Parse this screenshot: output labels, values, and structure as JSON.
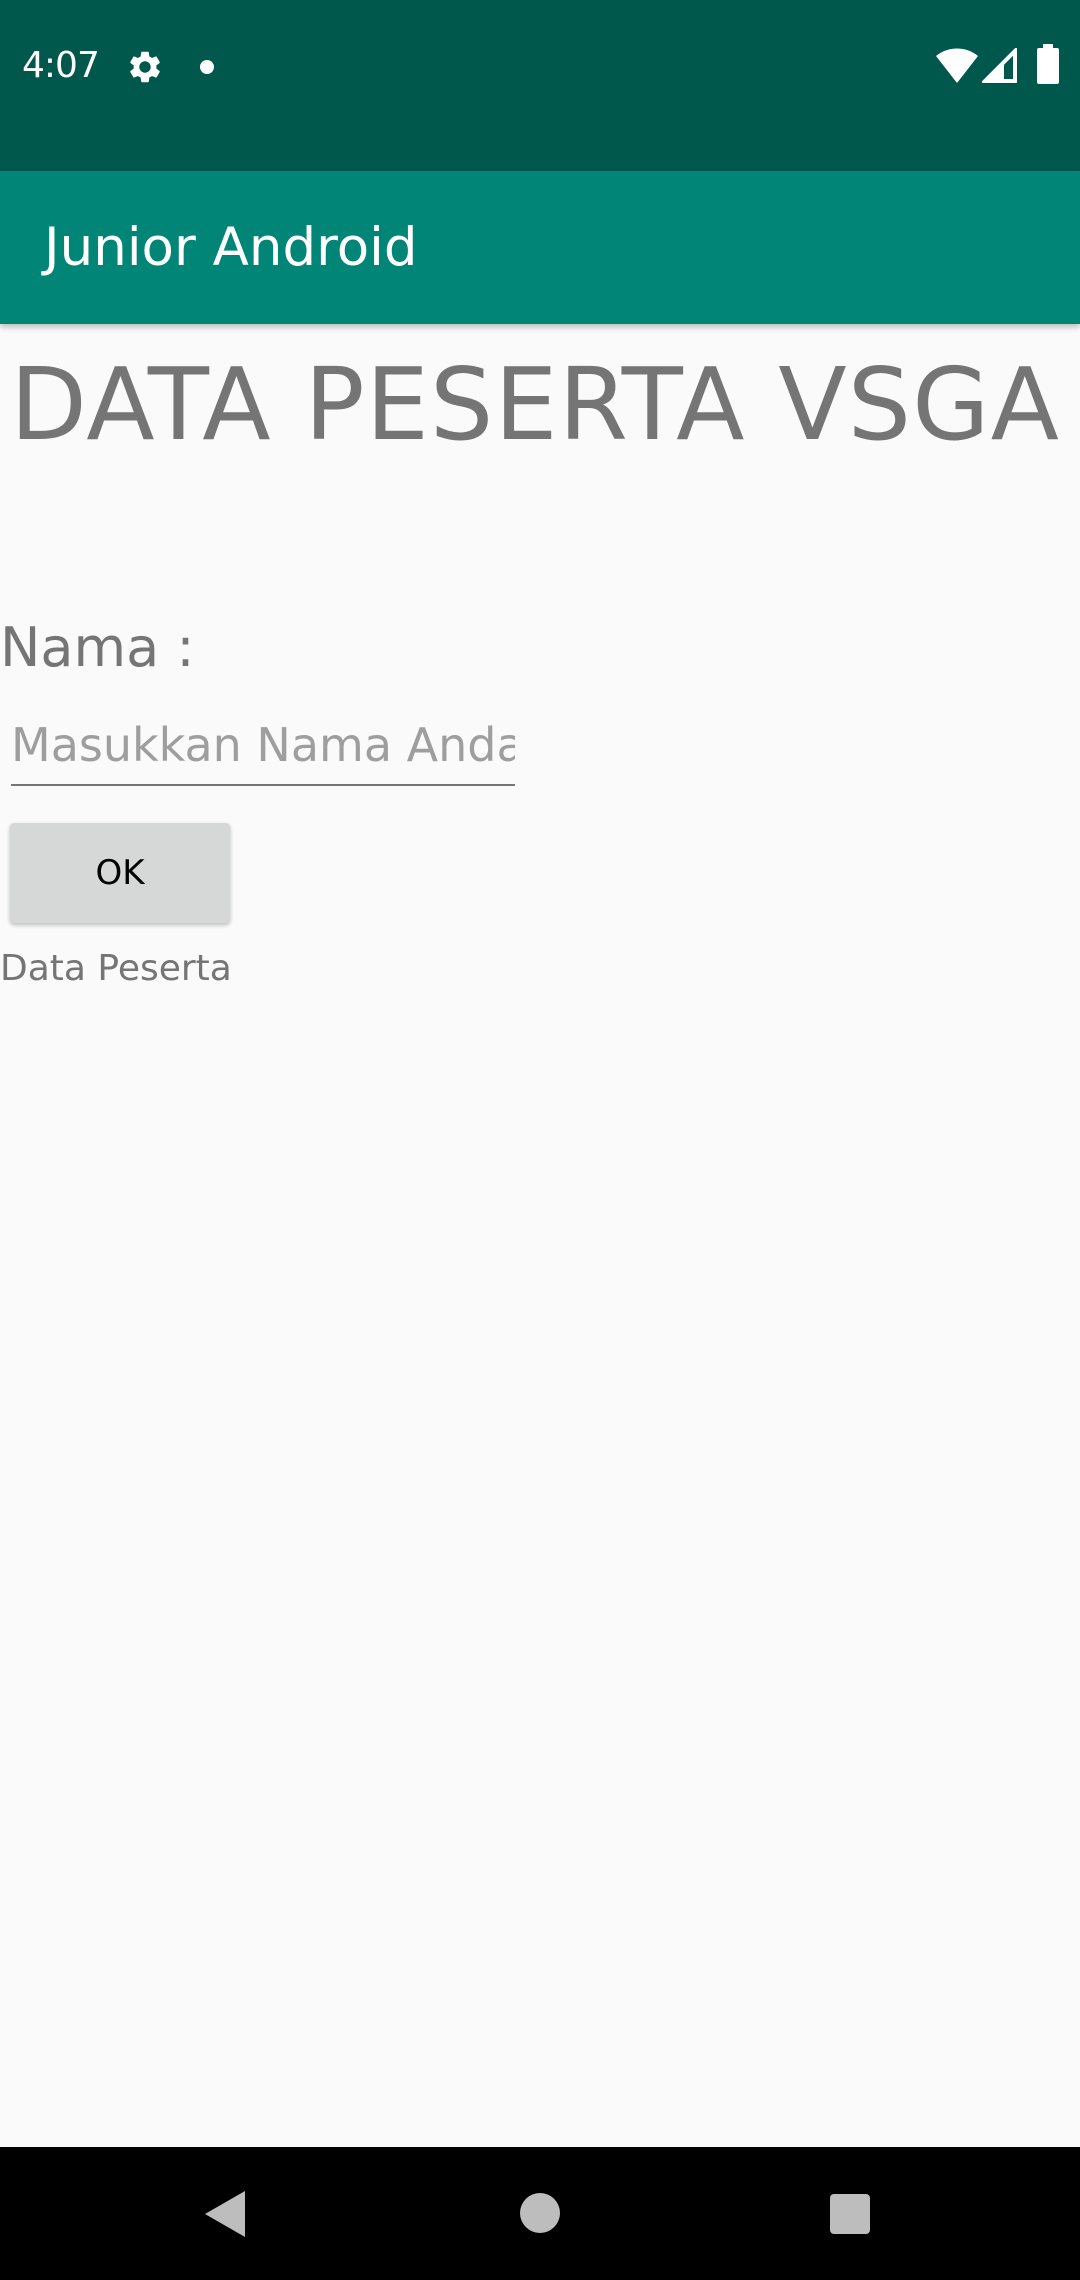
{
  "status_bar": {
    "time": "4:07",
    "icons": [
      "gear-icon",
      "notification-dot-icon",
      "wifi-icon",
      "signal-icon",
      "battery-icon"
    ]
  },
  "app_bar": {
    "title": "Junior Android"
  },
  "main": {
    "heading": "DATA PESERTA VSGA",
    "name_label": "Nama :",
    "name_input": {
      "value": "",
      "placeholder": "Masukkan Nama Anda"
    },
    "ok_button": "OK",
    "result_text": "Data Peserta"
  },
  "nav_bar": {
    "icons": [
      "back-icon",
      "home-icon",
      "recents-icon"
    ]
  },
  "colors": {
    "status_bar": "#00574b",
    "app_bar": "#008577",
    "background": "#fafafa",
    "button": "#d6d7d7",
    "text_gray": "#757575"
  }
}
